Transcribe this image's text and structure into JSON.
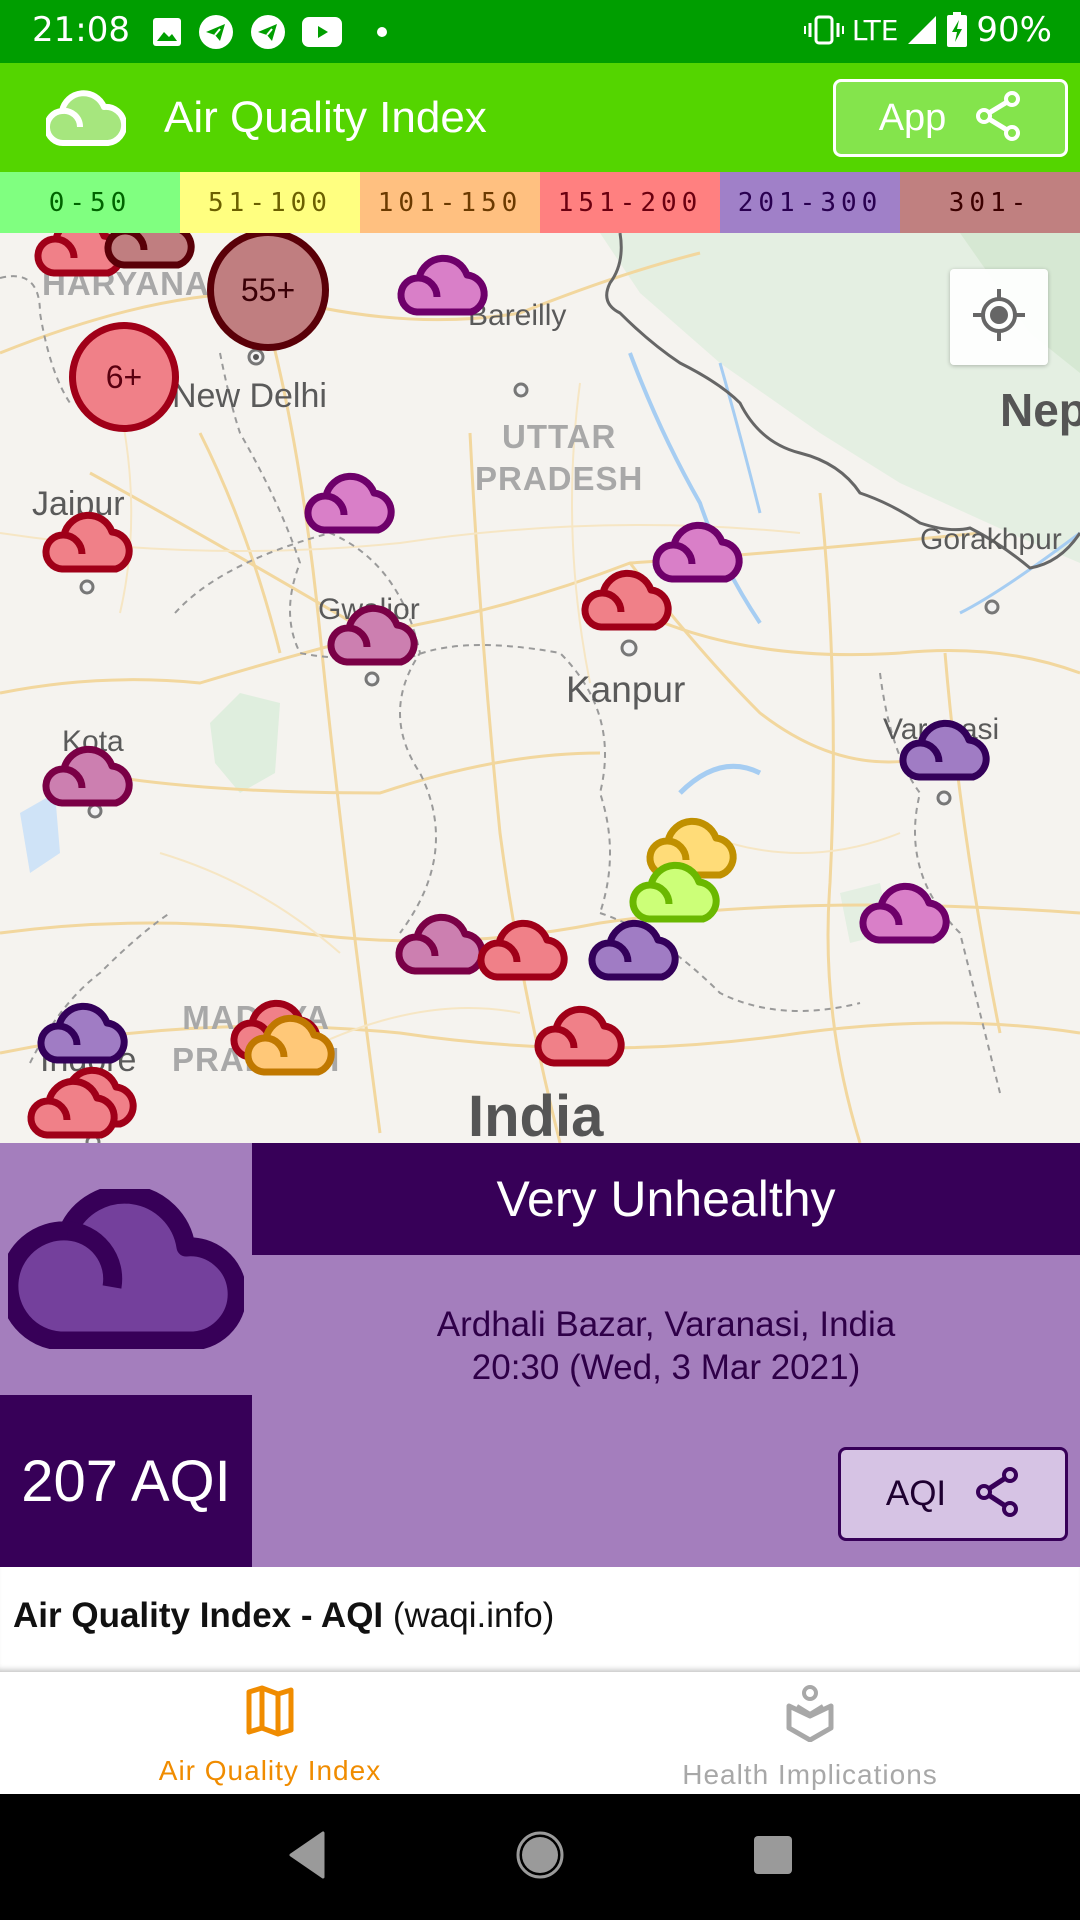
{
  "status_bar": {
    "time": "21:08",
    "left_icons": [
      "gallery-icon",
      "telegram-icon",
      "telegram-icon",
      "youtube-icon",
      "dot-icon"
    ],
    "network": "LTE",
    "battery": "90%"
  },
  "app_bar": {
    "title": "Air Quality Index",
    "share_button_label": "App",
    "colors": {
      "status": "#009e00",
      "bar": "#54d500"
    }
  },
  "legend": [
    {
      "range": "0-50",
      "bg": "#80ff80",
      "fg": "#006400"
    },
    {
      "range": "51-100",
      "bg": "#ffff80",
      "fg": "#6b6000"
    },
    {
      "range": "101-150",
      "bg": "#ffc080",
      "fg": "#6b3a00"
    },
    {
      "range": "151-200",
      "bg": "#ff8080",
      "fg": "#6b0010"
    },
    {
      "range": "201-300",
      "bg": "#a080c8",
      "fg": "#2a0050"
    },
    {
      "range": "301-",
      "bg": "#c08080",
      "fg": "#3c0000"
    }
  ],
  "map": {
    "labels": {
      "haryana": "HARYANA",
      "new_delhi": "New Delhi",
      "bareilly": "Bareilly",
      "uttar_pradesh_1": "UTTAR",
      "uttar_pradesh_2": "PRADESH",
      "nepal": "Nep",
      "jaipur": "Jaipur",
      "gorakhpur": "Gorakhpur",
      "gwalior": "Gwalior",
      "kanpur": "Kanpur",
      "kota": "Kota",
      "varanasi": "Varanasi",
      "madhya_pradesh_1": "MADHYA",
      "madhya_pradesh_2": "PRADESH",
      "indore": "Indore",
      "india": "India"
    },
    "clusters": [
      {
        "label": "55+",
        "level": "hazardous"
      },
      {
        "label": "6+",
        "level": "unhealthy"
      }
    ],
    "station_levels": {
      "hazardous": {
        "fill": "#c07e80",
        "stroke": "#5a0008"
      },
      "very_unhealthy_mauve": {
        "fill": "#cc7fb0",
        "stroke": "#7a0046"
      },
      "very_unhealthy_pink": {
        "fill": "#d97fc8",
        "stroke": "#6e006a"
      },
      "very_unhealthy": {
        "fill": "#a07cc4",
        "stroke": "#33005a"
      },
      "unhealthy": {
        "fill": "#f08088",
        "stroke": "#a00018"
      },
      "sensitive": {
        "fill": "#ffc878",
        "stroke": "#c07800"
      },
      "moderate": {
        "fill": "#ffdc78",
        "stroke": "#c09000"
      },
      "good": {
        "fill": "#ccff78",
        "stroke": "#6ab800"
      }
    },
    "stations": [
      "unhealthy",
      "hazardous",
      "unhealthy",
      "very_unhealthy_pink",
      "unhealthy",
      "very_unhealthy_pink",
      "unhealthy",
      "very_unhealthy_pink",
      "very_unhealthy_mauve",
      "very_unhealthy_mauve",
      "very_unhealthy",
      "moderate",
      "good",
      "very_unhealthy_pink",
      "very_unhealthy_mauve",
      "unhealthy",
      "very_unhealthy",
      "unhealthy",
      "sensitive",
      "very_unhealthy",
      "unhealthy",
      "unhealthy",
      "unhealthy"
    ]
  },
  "info_panel": {
    "category": "Very Unhealthy",
    "location": "Ardhali Bazar, Varanasi, India",
    "timestamp": "20:30 (Wed, 3 Mar 2021)",
    "aqi_value": "207 AQI",
    "share_button_label": "AQI",
    "colors": {
      "panel": "#a47ebd",
      "dark": "#370058",
      "icon_fill": "#74409c"
    }
  },
  "credit": {
    "bold": "Air Quality Index - AQI",
    "normal": " (waqi.info)"
  },
  "tabs": [
    {
      "label": "Air Quality Index",
      "icon": "map-icon",
      "active": true
    },
    {
      "label": "Health Implications",
      "icon": "health-reader-icon",
      "active": false
    }
  ],
  "nav": [
    "back",
    "home",
    "recents"
  ]
}
